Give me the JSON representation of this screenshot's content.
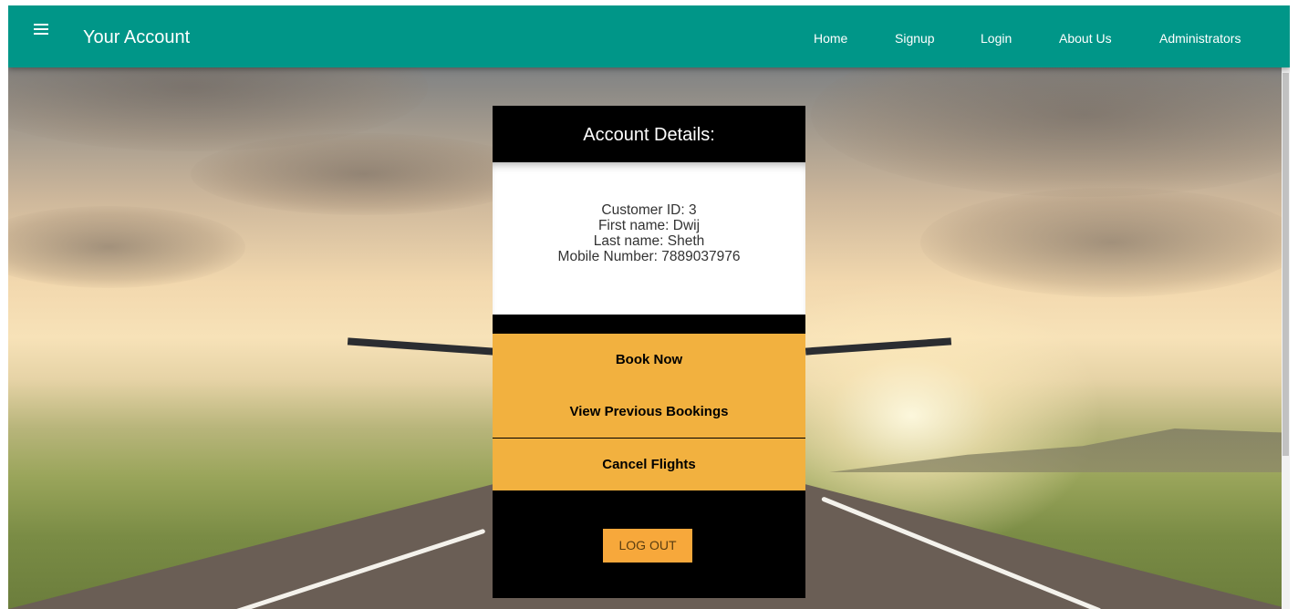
{
  "navbar": {
    "title": "Your Account",
    "links": [
      "Home",
      "Signup",
      "Login",
      "About Us",
      "Administrators"
    ],
    "color": "#009688"
  },
  "account": {
    "heading": "Account Details:",
    "customer_id": "Customer ID: 3",
    "first_name": "First name: Dwij",
    "last_name": "Last name: Sheth",
    "mobile": "Mobile Number: 7889037976"
  },
  "actions": {
    "book_now": "Book Now",
    "view_previous": "View Previous Bookings",
    "cancel_flights": "Cancel Flights",
    "logout": "LOG OUT",
    "accent": "#f2b13f"
  },
  "icons": {
    "menu": "hamburger-menu-icon"
  }
}
